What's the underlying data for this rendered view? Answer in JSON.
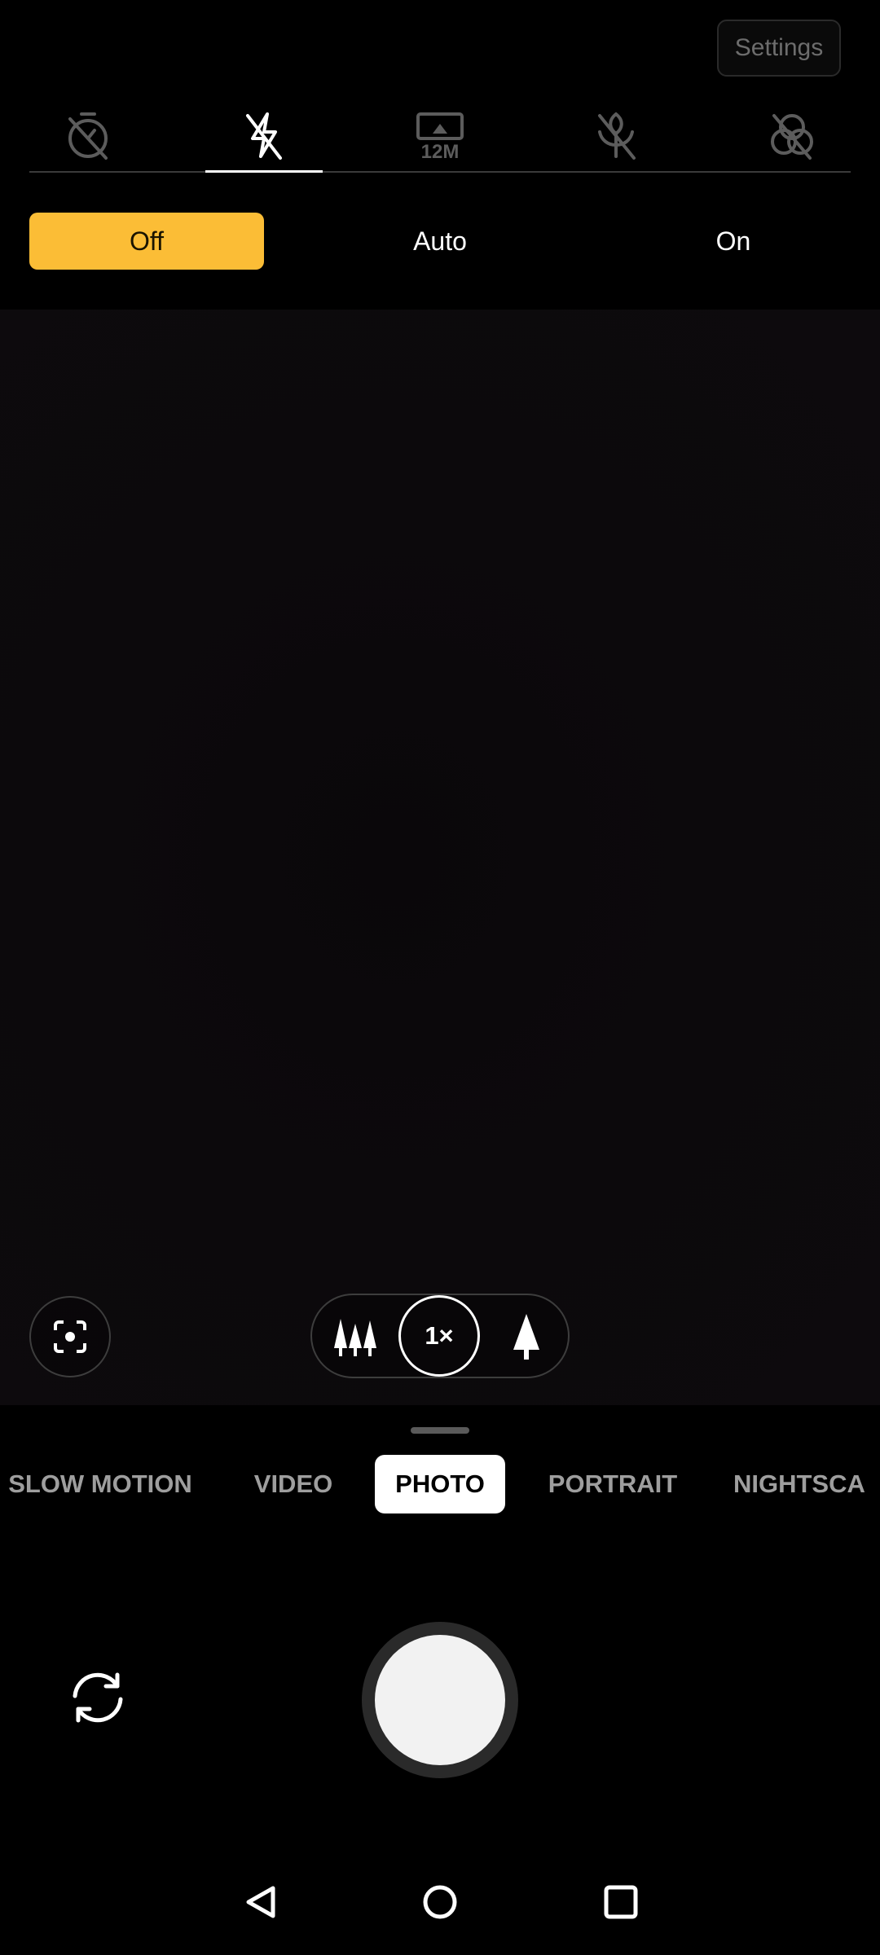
{
  "header": {
    "settings_label": "Settings"
  },
  "toolbar": {
    "items": [
      {
        "name": "timer-off-icon"
      },
      {
        "name": "flash-off-icon",
        "active": true
      },
      {
        "name": "resolution-icon",
        "label": "12M"
      },
      {
        "name": "macro-off-icon"
      },
      {
        "name": "filter-off-icon"
      }
    ]
  },
  "flash": {
    "options": [
      "Off",
      "Auto",
      "On"
    ],
    "selected": "Off",
    "accent_color": "#fbbd36"
  },
  "zoom": {
    "current": "1×",
    "wide_icon": "trees-icon",
    "tele_icon": "tree-icon"
  },
  "lens": {
    "icon": "google-lens-icon"
  },
  "modes": {
    "items": [
      "SLOW MOTION",
      "VIDEO",
      "PHOTO",
      "PORTRAIT",
      "NIGHTSCA"
    ],
    "selected": "PHOTO"
  },
  "controls": {
    "flip_icon": "switch-camera-icon",
    "shutter_icon": "shutter-button"
  },
  "navbar": {
    "icons": [
      "back-icon",
      "home-icon",
      "recents-icon"
    ]
  }
}
